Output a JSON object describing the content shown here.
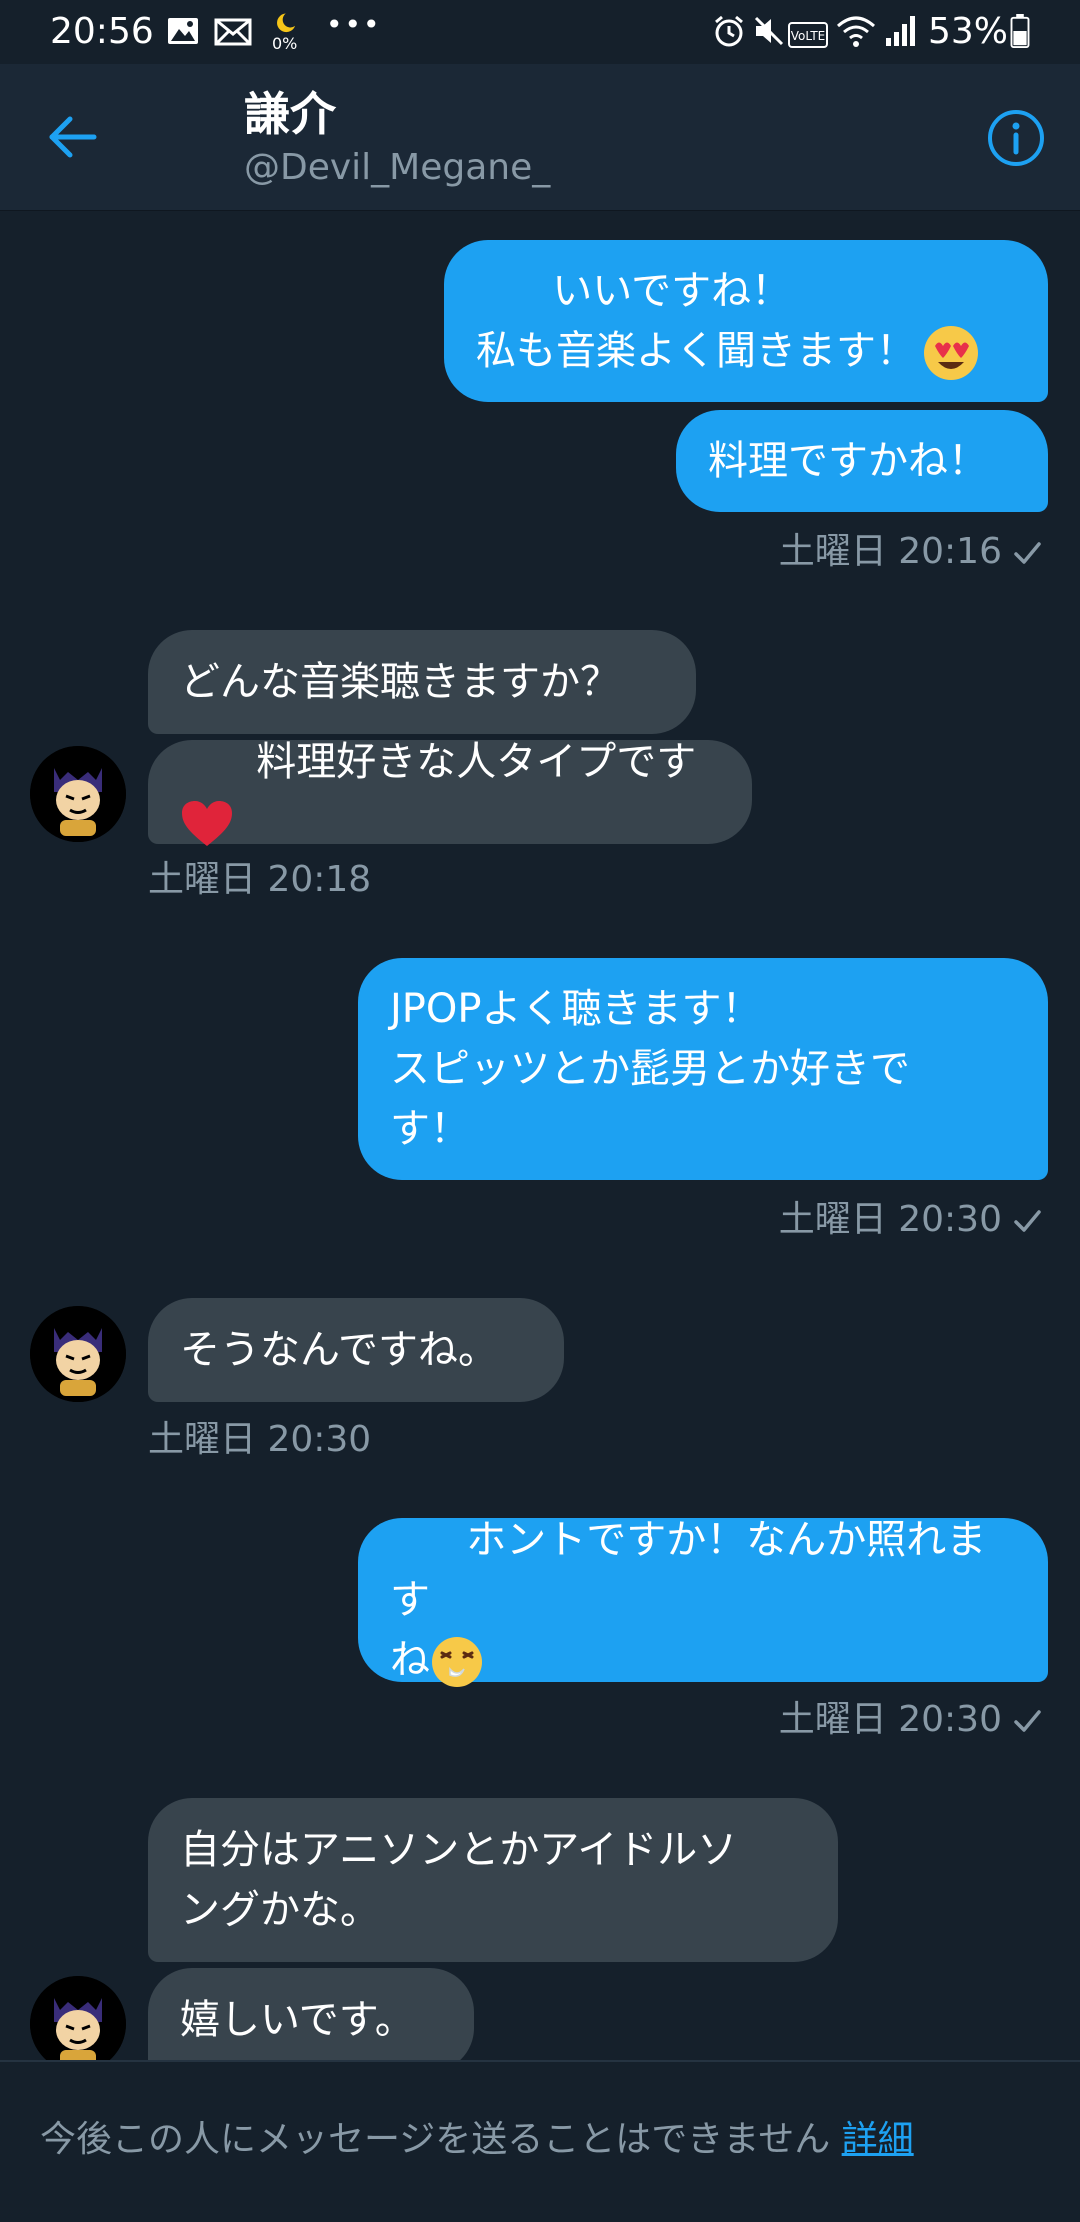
{
  "status_bar": {
    "time": "20:56",
    "battery_percent": "53%",
    "data_saver_label": "0%",
    "overflow_indicator": "•••",
    "icons": [
      "image-icon",
      "mail-icon",
      "moon-icon",
      "alarm-icon",
      "mute-icon",
      "volte-icon",
      "wifi-icon",
      "signal-icon",
      "battery-icon"
    ]
  },
  "header": {
    "name": "謙介",
    "handle": "@Devil_Megane_"
  },
  "messages": [
    {
      "direction": "sent",
      "text": "いいですね！\n私も音楽よく聞きます！"
    },
    {
      "direction": "sent",
      "text": "料理ですかね！"
    },
    {
      "direction": "sent",
      "timestamp": "土曜日 20:16"
    },
    {
      "direction": "received",
      "text": "どんな音楽聴きますか？"
    },
    {
      "direction": "received",
      "text": "料理好きな人タイプです"
    },
    {
      "direction": "received",
      "timestamp": "土曜日 20:18"
    },
    {
      "direction": "sent",
      "text": "JPOPよく聴きます！\nスピッツとか髭男とか好きで\nす！"
    },
    {
      "direction": "sent",
      "timestamp": "土曜日 20:30"
    },
    {
      "direction": "received",
      "text": "そうなんですね。"
    },
    {
      "direction": "received",
      "timestamp": "土曜日 20:30"
    },
    {
      "direction": "sent",
      "text": "ホントですか！なんか照れます\nね"
    },
    {
      "direction": "sent",
      "timestamp": "土曜日 20:30"
    },
    {
      "direction": "received",
      "text": "自分はアニソンとかアイドルソ\nングかな。"
    },
    {
      "direction": "received",
      "text": "嬉しいです。"
    }
  ],
  "footer": {
    "notice": "今後この人にメッセージを送ることはできません",
    "link": "詳細"
  },
  "colors": {
    "background": "#15202b",
    "header": "#1b2836",
    "sent_bubble": "#1da1f2",
    "received_bubble": "#38444d",
    "muted_text": "#8899a6",
    "accent": "#1da1f2"
  }
}
